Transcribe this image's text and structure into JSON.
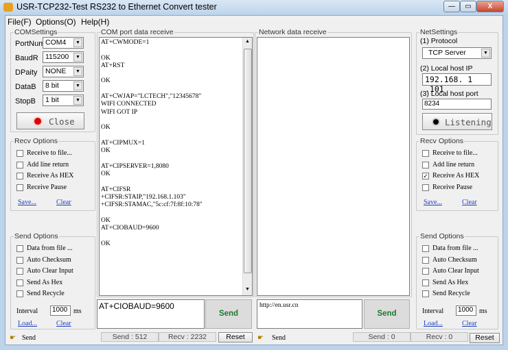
{
  "window": {
    "title": "USR-TCP232-Test  RS232 to Ethernet Convert tester",
    "minimize": "—",
    "maximize": "▭",
    "close": "X"
  },
  "menu": [
    "File(F)",
    "Options(O)",
    "Help(H)"
  ],
  "com_settings": {
    "legend": "COMSettings",
    "fields": [
      {
        "label": "PortNum",
        "value": "COM4"
      },
      {
        "label": "BaudR",
        "value": "115200"
      },
      {
        "label": "DPaity",
        "value": "NONE"
      },
      {
        "label": "DataB",
        "value": "8 bit"
      },
      {
        "label": "StopB",
        "value": "1 bit"
      }
    ],
    "button": "Close",
    "indicator_color": "#e00000"
  },
  "left_recv": {
    "legend": "Recv Options",
    "options": [
      {
        "label": "Receive to file...",
        "checked": false
      },
      {
        "label": "Add line return",
        "checked": false
      },
      {
        "label": "Receive As HEX",
        "checked": false
      },
      {
        "label": "Receive Pause",
        "checked": false
      }
    ],
    "save": "Save...",
    "clear": "Clear"
  },
  "left_send": {
    "legend": "Send Options",
    "options": [
      {
        "label": "Data from file ...",
        "checked": false
      },
      {
        "label": "Auto Checksum",
        "checked": false
      },
      {
        "label": "Auto Clear Input",
        "checked": false
      },
      {
        "label": "Send As Hex",
        "checked": false
      },
      {
        "label": "Send Recycle",
        "checked": false
      }
    ],
    "interval_label": "Interval",
    "interval": "1000",
    "unit": "ms",
    "load": "Load...",
    "clear": "Clear"
  },
  "com_receive": {
    "legend": "COM port data receive",
    "text": "AT+CWMODE=1\n\nOK\nAT+RST\n\nOK\n\nAT+CWJAP=\"LCTECH\",\"12345678\"\nWIFI CONNECTED\nWIFI GOT IP\n\nOK\n\nAT+CIPMUX=1\nOK\n\nAT+CIPSERVER=1,8080\nOK\n\nAT+CIFSR\n+CIFSR:STAIP,\"192.168.1.103\"\n+CIFSR:STAMAC,\"5c:cf:7f:8f:10:78\"\n\nOK\nAT+CIOBAUD=9600\n\nOK"
  },
  "net_receive": {
    "legend": "Network data receive",
    "text": ""
  },
  "net_settings": {
    "legend": "NetSettings",
    "protocol_label": "(1) Protocol",
    "protocol": "TCP Server",
    "ip_label": "(2) Local host IP",
    "ip": "192.168. 1 .101",
    "port_label": "(3) Local host port",
    "port": "8234",
    "button": "Listening",
    "indicator_color": "#000000"
  },
  "right_recv": {
    "legend": "Recv Options",
    "options": [
      {
        "label": "Receive to file...",
        "checked": false
      },
      {
        "label": "Add line return",
        "checked": false
      },
      {
        "label": "Receive As HEX",
        "checked": true
      },
      {
        "label": "Receive Pause",
        "checked": false
      }
    ],
    "save": "Save...",
    "clear": "Clear"
  },
  "right_send": {
    "legend": "Send Options",
    "options": [
      {
        "label": "Data from file ...",
        "checked": false
      },
      {
        "label": "Auto Checksum",
        "checked": false
      },
      {
        "label": "Auto Clear Input",
        "checked": false
      },
      {
        "label": "Send As Hex",
        "checked": false
      },
      {
        "label": "Send Recycle",
        "checked": false
      }
    ],
    "interval_label": "Interval",
    "interval": "1000",
    "unit": "ms",
    "load": "Load...",
    "clear": "Clear"
  },
  "com_send": {
    "input": "AT+CIOBAUD=9600",
    "button": "Send"
  },
  "net_send": {
    "input": "http://en.usr.cn",
    "button": "Send"
  },
  "status": {
    "left_label": "Send",
    "left_send": "Send : 512",
    "left_recv": "Recv : 2232",
    "left_reset": "Reset",
    "right_label": "Send",
    "right_send": "Send : 0",
    "right_recv": "Recv : 0",
    "right_reset": "Reset"
  }
}
